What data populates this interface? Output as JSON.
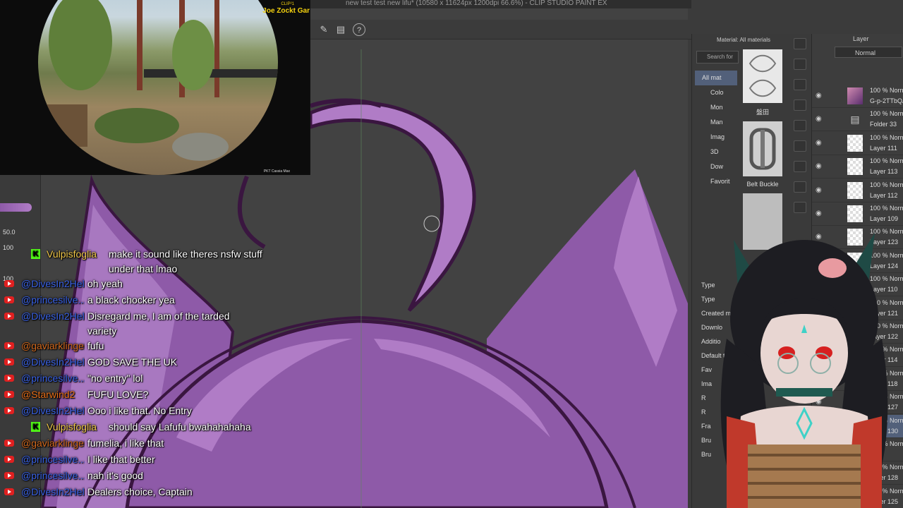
{
  "app": {
    "title": "new test test new lifu* (10580 x 11624px 1200dpi 66.6%) - CLIP STUDIO PAINT EX"
  },
  "colors": {
    "accent_purple": "#8e5aa8",
    "light_purple": "#b07cc6",
    "dark_outline": "#3a1640",
    "youtube_red": "#e02020",
    "kick_green": "#53fc18"
  },
  "toolbar": {
    "icons": [
      "pen-icon",
      "folder-icon",
      "help-icon"
    ]
  },
  "gamecam": {
    "clip_label": "CLIP²1",
    "streamer_name": "Joe Zockt Gar",
    "bottom_right": "PKT Cassia Max"
  },
  "leftpanel": {
    "values": [
      "50.0",
      "100",
      "100"
    ]
  },
  "chat": {
    "messages": [
      {
        "platform": "kick",
        "user": "Vulpisfoglia",
        "user_color": "#f1c84a",
        "text": "make it sound like theres nsfw stuff under that lmao"
      },
      {
        "platform": "youtube",
        "user": "@DivesIn2Hell4...",
        "user_color": "#3b63e6",
        "text": "oh yeah"
      },
      {
        "platform": "youtube",
        "user": "@princesilve...",
        "user_color": "#3b63e6",
        "text": "a black chocker yea"
      },
      {
        "platform": "youtube",
        "user": "@DivesIn2Hell4...",
        "user_color": "#3b63e6",
        "text": "Disregard me, I am of the tarded variety"
      },
      {
        "platform": "youtube",
        "user": "@gaviarklinger...",
        "user_color": "#d2691e",
        "text": "fufu"
      },
      {
        "platform": "youtube",
        "user": "@DivesIn2Hell4...",
        "user_color": "#3b63e6",
        "text": "GOD SAVE THE UK"
      },
      {
        "platform": "youtube",
        "user": "@princesilve...",
        "user_color": "#3b63e6",
        "text": "\"no entry\" lol"
      },
      {
        "platform": "youtube",
        "user": "@Starwind2",
        "user_color": "#e8701a",
        "text": "FUFU LOVE?"
      },
      {
        "platform": "youtube",
        "user": "@DivesIn2Hell4...",
        "user_color": "#3b63e6",
        "text": "Ooo i like that. No Entry"
      },
      {
        "platform": "kick",
        "user": "Vulpisfoglia",
        "user_color": "#f1c84a",
        "text": "should say Lafufu bwahahahaha"
      },
      {
        "platform": "youtube",
        "user": "@gaviarklinger...",
        "user_color": "#d2691e",
        "text": "fumelia, i like that"
      },
      {
        "platform": "youtube",
        "user": "@princesilve...",
        "user_color": "#3b63e6",
        "text": "I like that better"
      },
      {
        "platform": "youtube",
        "user": "@princesilve...",
        "user_color": "#3b63e6",
        "text": "nah it's good"
      },
      {
        "platform": "youtube",
        "user": "@DivesIn2Hell4...",
        "user_color": "#3b63e6",
        "text": "Dealers choice, Captain"
      }
    ]
  },
  "material": {
    "header": "Material: All materials",
    "search": "Search for",
    "tree": [
      "All mat",
      "Colo",
      "Mon",
      "Man",
      "Imag",
      "3D",
      "Dow",
      "Favorit"
    ],
    "items": [
      "盤田",
      "Belt Buckle"
    ],
    "lower": [
      "Type",
      "Type",
      "Created m",
      "Downlo",
      "Additio",
      "Default ta",
      "Fav",
      "Ima",
      "R",
      "R",
      "Fra",
      "Bru",
      "Bru"
    ]
  },
  "layers": {
    "title": "Layer",
    "blend_mode": "Normal",
    "rows": [
      {
        "opacity": "100 % Norn",
        "name": "G-p-2TTbQAMC",
        "thumb": "art",
        "selected": false
      },
      {
        "opacity": "100 % Normal",
        "name": "Folder 33",
        "thumb": "folder",
        "selected": false
      },
      {
        "opacity": "100 % Norma",
        "name": "Layer 111",
        "thumb": "blank",
        "selected": false
      },
      {
        "opacity": "100 % Norma",
        "name": "Layer 113",
        "thumb": "blank",
        "selected": false
      },
      {
        "opacity": "100 % Norma",
        "name": "Layer 112",
        "thumb": "blank",
        "selected": false
      },
      {
        "opacity": "100 % Norma",
        "name": "Layer 109",
        "thumb": "blank",
        "selected": false
      },
      {
        "opacity": "100 % Norma",
        "name": "Layer 123",
        "thumb": "blank",
        "selected": false
      },
      {
        "opacity": "100 % Norma",
        "name": "Layer 124",
        "thumb": "blank",
        "selected": false
      },
      {
        "opacity": "100 % Norma",
        "name": "Layer 110",
        "thumb": "blank",
        "selected": false
      },
      {
        "opacity": "100 % Norma",
        "name": "Layer 121",
        "thumb": "blank",
        "selected": false
      },
      {
        "opacity": "100 % Norma",
        "name": "Layer 122",
        "thumb": "blank",
        "selected": false
      },
      {
        "opacity": "100 % Norma",
        "name": "Layer 114",
        "thumb": "blank",
        "selected": false
      },
      {
        "opacity": "100 % Norma",
        "name": "Layer 118",
        "thumb": "blank",
        "selected": false
      },
      {
        "opacity": "100 % Norma",
        "name": "Layer 127",
        "thumb": "blank",
        "selected": false
      },
      {
        "opacity": "100 % Norma",
        "name": "Layer 130",
        "thumb": "blank",
        "selected": true
      },
      {
        "opacity": "100 % Normal",
        "name": "34",
        "thumb": "folder",
        "selected": false
      },
      {
        "opacity": "100 % Norma",
        "name": "Layer 128",
        "thumb": "blank",
        "selected": false
      },
      {
        "opacity": "100 % Norma",
        "name": "Layer 125",
        "thumb": "blank",
        "selected": false
      }
    ]
  }
}
